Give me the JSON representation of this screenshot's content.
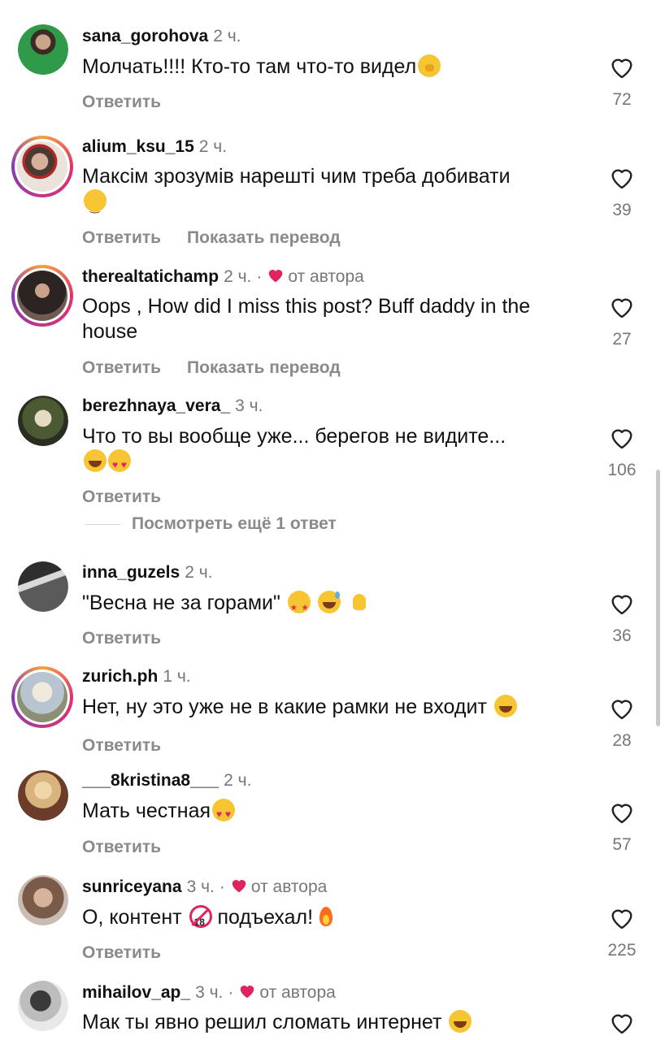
{
  "actions": {
    "reply": "Ответить",
    "translate": "Показать перевод"
  },
  "author_label": "от автора",
  "more_replies": "Посмотреть ещё 1 ответ",
  "comments": [
    {
      "user": "sana_gorohova",
      "time": "2 ч.",
      "text": "Молчать!!!! Кто-то там что-то видел",
      "likes": "72"
    },
    {
      "user": "alium_ksu_15",
      "time": "2 ч.",
      "text": "Максім зрозумів нарешті чим треба добивати",
      "likes": "39"
    },
    {
      "user": "therealtatichamp",
      "time": "2 ч.",
      "text": "Oops , How did I miss this post? Buff daddy in the house",
      "likes": "27"
    },
    {
      "user": "berezhnaya_vera_",
      "time": "3 ч.",
      "text": "Что то вы вообще уже... берегов не видите...",
      "likes": "106"
    },
    {
      "user": "inna_guzels",
      "time": "2 ч.",
      "text": "\"Весна не за горами\"",
      "likes": "36"
    },
    {
      "user": "zurich.ph",
      "time": "1 ч.",
      "text": "Нет, ну это уже не в какие рамки не входит",
      "likes": "28"
    },
    {
      "user": "___8kristina8___",
      "time": "2 ч.",
      "text": "Мать честная",
      "likes": "57"
    },
    {
      "user": "sunriceyana",
      "time": "3 ч.",
      "text_a": "О, контент",
      "text_b": "подъехал!",
      "likes": "225"
    },
    {
      "user": "mihailov_ap_",
      "time": "3 ч.",
      "text": "Мак ты явно решил сломать интернет"
    }
  ],
  "colors": {
    "heart_red": "#e0245e",
    "muted": "#777777",
    "actions": "#8a8a8a"
  }
}
